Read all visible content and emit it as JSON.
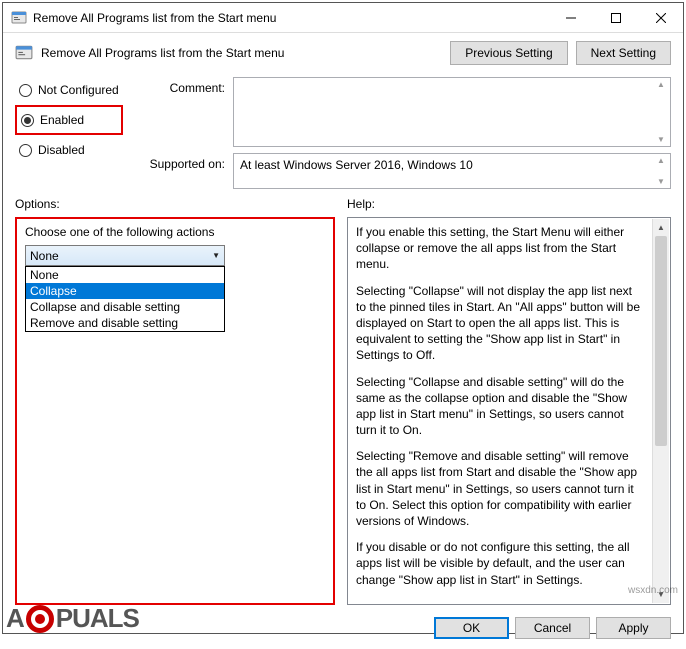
{
  "window": {
    "title": "Remove All Programs list from the Start menu",
    "minimize_tip": "Minimize",
    "maximize_tip": "Maximize",
    "close_tip": "Close"
  },
  "header": {
    "title": "Remove All Programs list from the Start menu",
    "previous_label": "Previous Setting",
    "next_label": "Next Setting"
  },
  "states": {
    "not_configured": "Not Configured",
    "enabled": "Enabled",
    "disabled": "Disabled",
    "selected": "enabled"
  },
  "meta": {
    "comment_label": "Comment:",
    "comment_value": "",
    "supported_label": "Supported on:",
    "supported_value": "At least Windows Server 2016, Windows 10"
  },
  "columns": {
    "options_label": "Options:",
    "help_label": "Help:"
  },
  "options": {
    "caption": "Choose one of the following actions",
    "selected_value": "None",
    "items": [
      "None",
      "Collapse",
      "Collapse and disable setting",
      "Remove and disable setting"
    ],
    "highlighted_index": 1
  },
  "help": {
    "paragraphs": [
      "If you enable this setting, the Start Menu will either collapse or remove the all apps list from the Start menu.",
      "Selecting \"Collapse\" will not display the app list next to the pinned tiles in Start. An \"All apps\" button will be displayed on Start to open the all apps list. This is equivalent to setting the \"Show app list in Start\" in Settings to Off.",
      "Selecting \"Collapse and disable setting\" will do the same as the collapse option and disable the \"Show app list in Start menu\" in Settings, so users cannot turn it to On.",
      "Selecting \"Remove and disable setting\" will remove the all apps list from Start and disable the \"Show app list in Start menu\" in Settings, so users cannot turn it to On. Select this option for compatibility with earlier versions of Windows.",
      "If you disable or do not configure this setting, the all apps list will be visible by default, and the user can change \"Show app list in Start\" in Settings."
    ]
  },
  "buttons": {
    "ok": "OK",
    "cancel": "Cancel",
    "apply": "Apply"
  },
  "watermark": {
    "brand_before": "A",
    "brand_after": "PUALS",
    "url": "wsxdn.com"
  }
}
